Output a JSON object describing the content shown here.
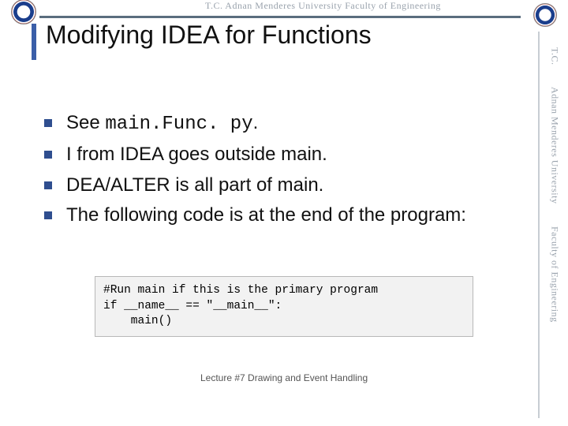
{
  "banner": {
    "top_text": "T.C.    Adnan Menderes University     Faculty of Engineering",
    "right_segments": [
      "T.C.",
      "Adnan Menderes University",
      "Faculty of Engineering"
    ]
  },
  "title": "Modifying IDEA for Functions",
  "bullets": [
    {
      "pre": "See ",
      "code": "main.Func. py",
      "post": "."
    },
    {
      "text": "I from IDEA goes outside main."
    },
    {
      "text": "DEA/ALTER is all part of main."
    },
    {
      "text": "The following code is at the end of the program:"
    }
  ],
  "code_lines": [
    "#Run main if this is the primary program",
    "if __name__ == \"__main__\":",
    "    main()"
  ],
  "footer": "Lecture #7 Drawing and Event Handling"
}
